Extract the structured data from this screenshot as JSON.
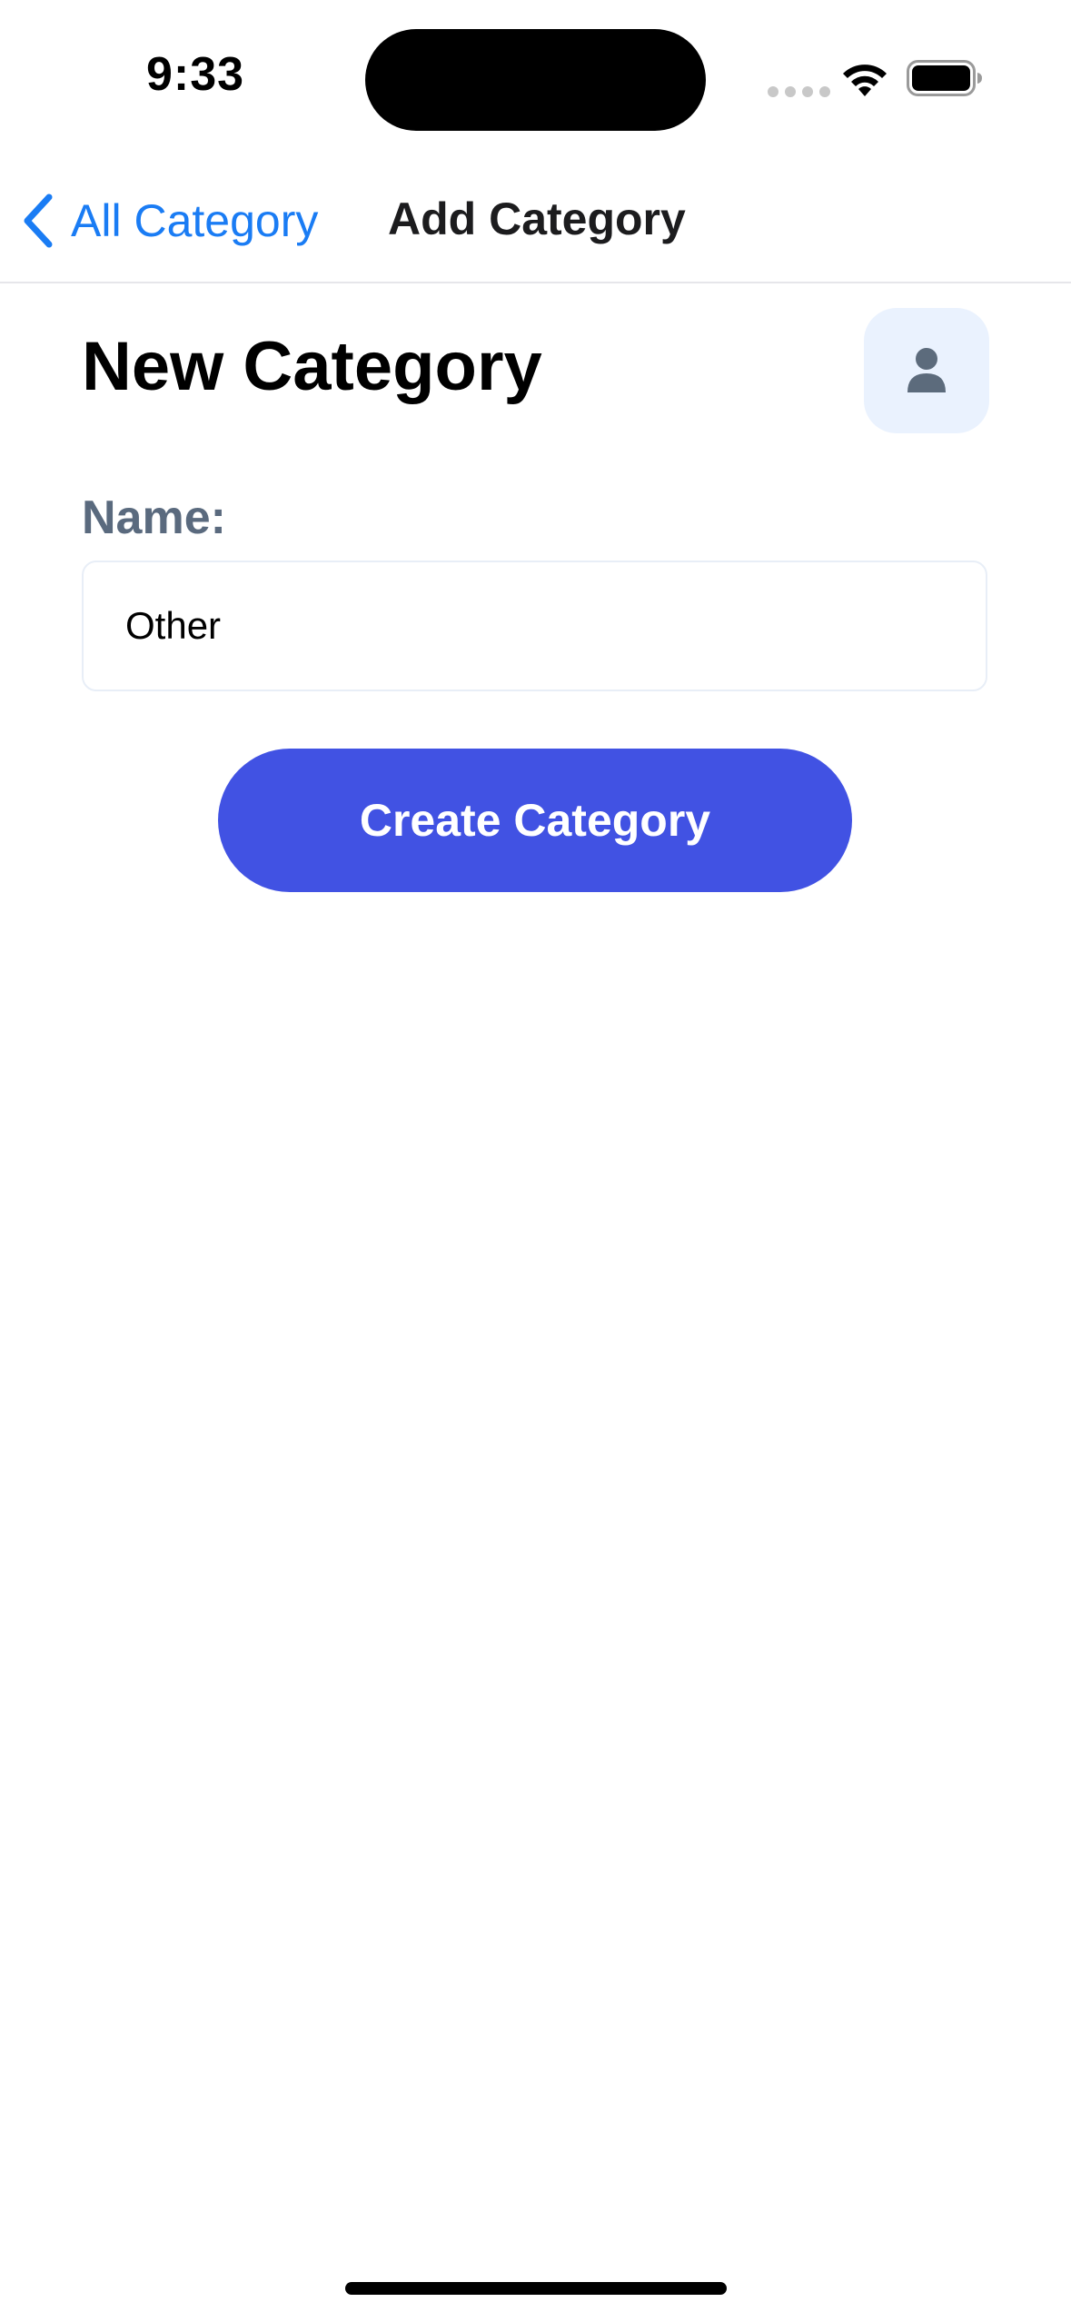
{
  "status_bar": {
    "time": "9:33",
    "icons": [
      "signal-icon",
      "wifi-icon",
      "battery-icon"
    ]
  },
  "nav": {
    "back_label": "All Category",
    "title": "Add Category",
    "back_icon": "chevron-left-icon"
  },
  "page": {
    "title": "New Category",
    "profile_icon": "person-icon"
  },
  "form": {
    "name_label": "Name:",
    "name_value": "Other",
    "submit_label": "Create Category"
  },
  "colors": {
    "accent": "#1a7cf4",
    "primary_button": "#4152e3",
    "label_gray": "#5a6a7e",
    "profile_bg": "#eaf2fe"
  }
}
